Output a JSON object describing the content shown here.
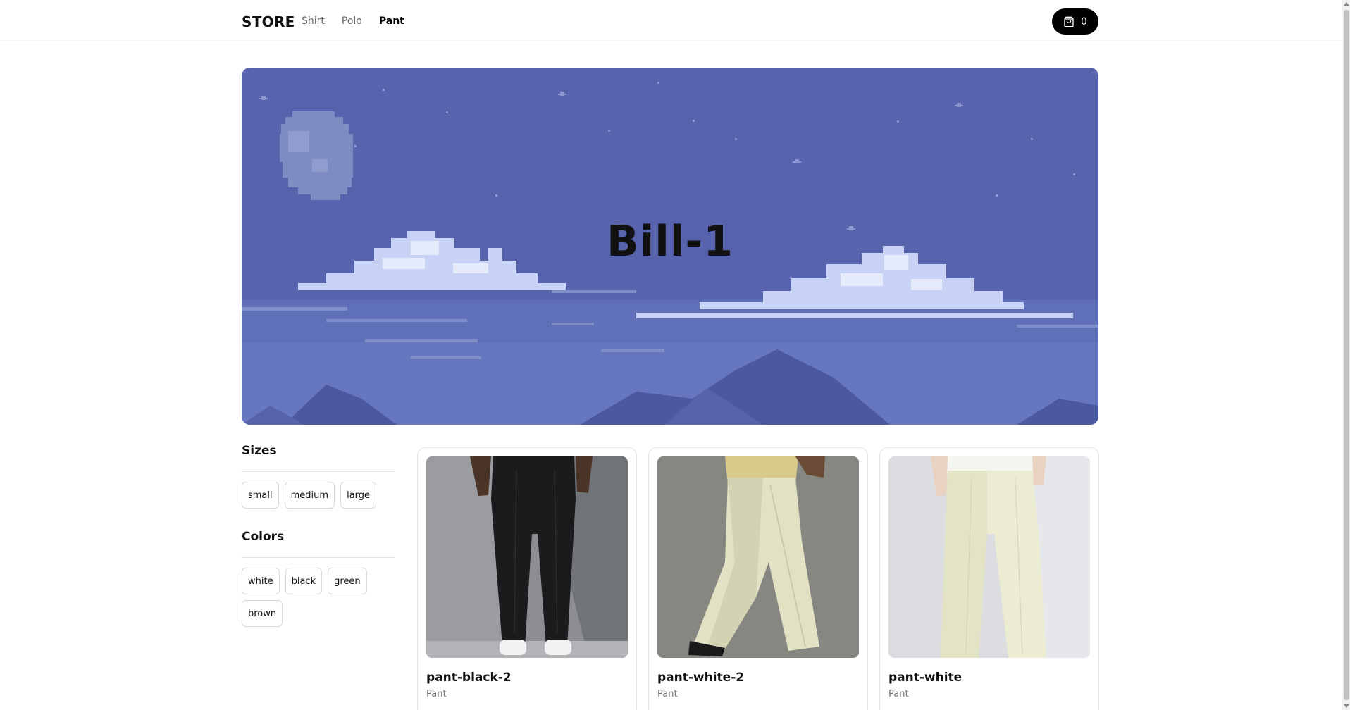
{
  "header": {
    "logo": "STORE",
    "nav": [
      {
        "label": "Shirt",
        "active": false
      },
      {
        "label": "Polo",
        "active": false
      },
      {
        "label": "Pant",
        "active": true
      }
    ],
    "cart_icon": "shopping-bag-icon",
    "cart_count": "0"
  },
  "hero": {
    "title": "Bill-1",
    "background_color": "#5a68b0"
  },
  "filters": {
    "sizes": {
      "heading": "Sizes",
      "options": [
        "small",
        "medium",
        "large"
      ]
    },
    "colors": {
      "heading": "Colors",
      "options": [
        "white",
        "black",
        "green",
        "brown"
      ]
    }
  },
  "products": [
    {
      "name": "pant-black-2",
      "category": "Pant"
    },
    {
      "name": "pant-white-2",
      "category": "Pant"
    },
    {
      "name": "pant-white",
      "category": "Pant"
    }
  ],
  "colors": {
    "accent": "#000000",
    "border": "#e5e5e5",
    "muted_text": "#777777"
  }
}
